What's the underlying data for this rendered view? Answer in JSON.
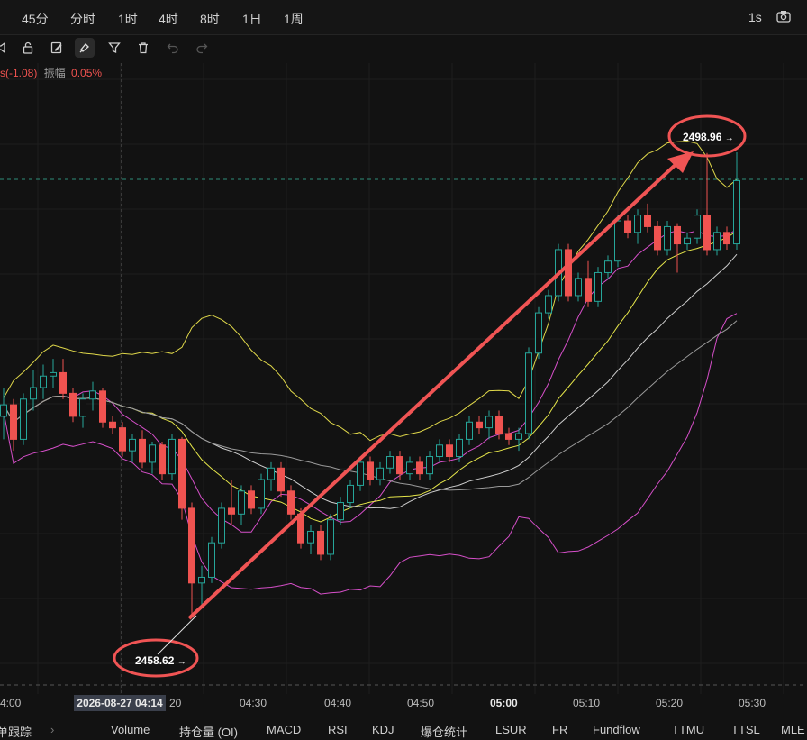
{
  "toolbar": {
    "timeframes": [
      "45分",
      "分时",
      "1时",
      "4时",
      "8时",
      "1日",
      "1周"
    ],
    "right_interval": "1s"
  },
  "info_bar": {
    "change_text": "s(-1.08)",
    "amplitude_label": "振幅",
    "amplitude_value": "0.05%"
  },
  "annotations": {
    "low_price": "2458.62",
    "high_price": "2498.96",
    "arrow_glyph": "→"
  },
  "x_axis": {
    "labels": [
      "4:00",
      "20",
      "04:30",
      "04:40",
      "04:50",
      "05:00",
      "05:10",
      "05:20",
      "05:30"
    ],
    "cursor_time": "2026-08-27 04:14"
  },
  "bottom_tabs": [
    "单跟踪",
    "Volume",
    "持仓量 (OI)",
    "MACD",
    "RSI",
    "KDJ",
    "爆仓统计",
    "LSUR",
    "FR",
    "Fundflow",
    "TTMU",
    "TTSL",
    "MLE"
  ],
  "colors": {
    "up": "#26a69a",
    "down": "#ef5350",
    "annotation": "#f05454",
    "boll_upper": "#e0d84a",
    "boll_lower": "#d64fc9"
  },
  "chart_data": {
    "type": "candlestick",
    "start_time": "04:00",
    "interval_seconds": 15,
    "ylim": [
      2452,
      2505
    ],
    "candles": [
      [
        2476.0,
        2478.5,
        2474.0,
        2477.0
      ],
      [
        2477.0,
        2477.5,
        2473.0,
        2474.0
      ],
      [
        2474.0,
        2478.0,
        2473.5,
        2477.5
      ],
      [
        2477.5,
        2480.0,
        2476.5,
        2478.5
      ],
      [
        2478.5,
        2480.5,
        2477.5,
        2479.5
      ],
      [
        2479.5,
        2481.0,
        2478.5,
        2479.8
      ],
      [
        2479.8,
        2481.0,
        2477.5,
        2478.0
      ],
      [
        2478.0,
        2478.5,
        2475.5,
        2476.0
      ],
      [
        2476.0,
        2478.0,
        2475.0,
        2477.5
      ],
      [
        2477.5,
        2479.0,
        2476.5,
        2478.2
      ],
      [
        2478.2,
        2478.5,
        2475.0,
        2475.5
      ],
      [
        2475.5,
        2476.0,
        2474.5,
        2475.0
      ],
      [
        2475.0,
        2475.5,
        2472.5,
        2473.0
      ],
      [
        2473.0,
        2474.5,
        2472.0,
        2474.0
      ],
      [
        2474.0,
        2474.8,
        2471.5,
        2472.0
      ],
      [
        2472.0,
        2473.8,
        2471.0,
        2473.5
      ],
      [
        2473.5,
        2473.8,
        2470.5,
        2471.0
      ],
      [
        2471.0,
        2474.5,
        2470.5,
        2474.0
      ],
      [
        2474.0,
        2474.2,
        2467.0,
        2468.0
      ],
      [
        2468.0,
        2468.5,
        2458.6,
        2461.5
      ],
      [
        2461.5,
        2463.0,
        2459.5,
        2462.0
      ],
      [
        2462.0,
        2465.5,
        2461.5,
        2465.0
      ],
      [
        2465.0,
        2468.5,
        2464.5,
        2468.0
      ],
      [
        2468.0,
        2470.5,
        2466.5,
        2467.5
      ],
      [
        2467.5,
        2470.0,
        2466.5,
        2469.5
      ],
      [
        2469.5,
        2470.0,
        2467.5,
        2468.0
      ],
      [
        2468.0,
        2471.0,
        2467.5,
        2470.5
      ],
      [
        2470.5,
        2472.0,
        2469.5,
        2471.5
      ],
      [
        2471.5,
        2472.0,
        2469.0,
        2469.5
      ],
      [
        2469.5,
        2470.0,
        2467.0,
        2467.5
      ],
      [
        2467.5,
        2468.0,
        2464.5,
        2465.0
      ],
      [
        2465.0,
        2466.5,
        2464.0,
        2466.0
      ],
      [
        2466.0,
        2466.5,
        2463.5,
        2464.0
      ],
      [
        2464.0,
        2467.5,
        2463.5,
        2467.0
      ],
      [
        2467.0,
        2469.0,
        2466.5,
        2468.5
      ],
      [
        2468.5,
        2470.5,
        2468.0,
        2470.0
      ],
      [
        2470.0,
        2472.5,
        2469.5,
        2472.0
      ],
      [
        2472.0,
        2472.5,
        2470.0,
        2470.5
      ],
      [
        2470.5,
        2472.0,
        2470.0,
        2471.5
      ],
      [
        2471.5,
        2473.0,
        2471.0,
        2472.5
      ],
      [
        2472.5,
        2473.0,
        2470.5,
        2471.0
      ],
      [
        2471.0,
        2472.5,
        2470.5,
        2472.0
      ],
      [
        2472.0,
        2472.5,
        2470.5,
        2471.0
      ],
      [
        2471.0,
        2473.0,
        2470.5,
        2472.5
      ],
      [
        2472.5,
        2474.0,
        2472.0,
        2473.5
      ],
      [
        2473.5,
        2474.0,
        2472.0,
        2472.5
      ],
      [
        2472.5,
        2474.5,
        2472.0,
        2474.0
      ],
      [
        2474.0,
        2476.0,
        2473.5,
        2475.5
      ],
      [
        2475.5,
        2476.0,
        2474.5,
        2475.0
      ],
      [
        2475.0,
        2476.5,
        2474.0,
        2476.0
      ],
      [
        2476.0,
        2476.5,
        2474.0,
        2474.5
      ],
      [
        2474.5,
        2475.0,
        2473.5,
        2474.0
      ],
      [
        2474.0,
        2475.0,
        2473.0,
        2474.5
      ],
      [
        2474.5,
        2482.0,
        2474.0,
        2481.5
      ],
      [
        2481.5,
        2485.5,
        2481.0,
        2485.0
      ],
      [
        2485.0,
        2487.0,
        2484.5,
        2486.5
      ],
      [
        2486.5,
        2491.0,
        2486.0,
        2490.5
      ],
      [
        2490.5,
        2491.0,
        2486.0,
        2486.5
      ],
      [
        2486.5,
        2488.5,
        2486.0,
        2488.0
      ],
      [
        2488.0,
        2489.5,
        2485.5,
        2486.0
      ],
      [
        2486.0,
        2489.0,
        2485.5,
        2488.5
      ],
      [
        2488.5,
        2490.0,
        2488.0,
        2489.5
      ],
      [
        2489.5,
        2493.5,
        2489.0,
        2493.0
      ],
      [
        2493.0,
        2493.5,
        2491.5,
        2492.0
      ],
      [
        2492.0,
        2494.0,
        2491.0,
        2493.5
      ],
      [
        2493.5,
        2494.5,
        2492.0,
        2492.5
      ],
      [
        2492.5,
        2493.0,
        2490.0,
        2490.5
      ],
      [
        2490.5,
        2493.0,
        2490.0,
        2492.5
      ],
      [
        2492.5,
        2492.8,
        2488.5,
        2491.0
      ],
      [
        2491.0,
        2492.0,
        2490.5,
        2491.5
      ],
      [
        2491.5,
        2494.0,
        2491.0,
        2493.5
      ],
      [
        2493.5,
        2498.9,
        2490.0,
        2490.5
      ],
      [
        2490.5,
        2492.5,
        2490.0,
        2492.0
      ],
      [
        2492.0,
        2492.5,
        2490.5,
        2491.0
      ],
      [
        2491.0,
        2498.96,
        2490.5,
        2496.5
      ]
    ]
  }
}
